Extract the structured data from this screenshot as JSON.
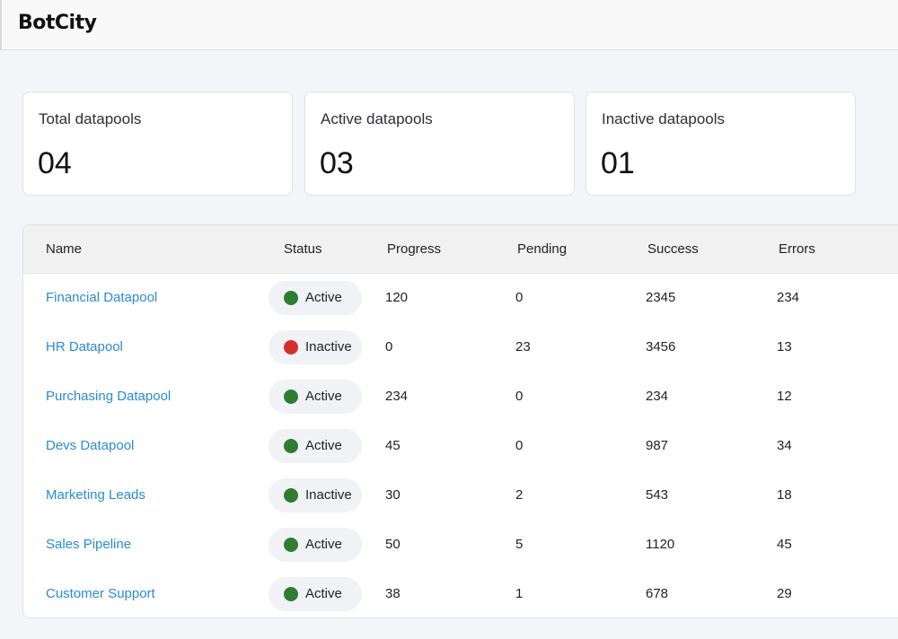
{
  "app": {
    "logo": "BotCity"
  },
  "summary": [
    {
      "label": "Total datapools",
      "value": "04"
    },
    {
      "label": "Active datapools",
      "value": "03"
    },
    {
      "label": "Inactive datapools",
      "value": "01"
    }
  ],
  "table": {
    "headers": [
      "Name",
      "Status",
      "Progress",
      "Pending",
      "Success",
      "Errors"
    ],
    "rows": [
      {
        "name": "Financial Datapool",
        "status": "Active",
        "status_color": "#2e7d32",
        "progress": "120",
        "pending": "0",
        "success": "2345",
        "errors": "234"
      },
      {
        "name": "HR Datapool",
        "status": "Inactive",
        "status_color": "#d32f2f",
        "progress": "0",
        "pending": "23",
        "success": "3456",
        "errors": "13"
      },
      {
        "name": "Purchasing Datapool",
        "status": "Active",
        "status_color": "#2e7d32",
        "progress": "234",
        "pending": "0",
        "success": "234",
        "errors": "12"
      },
      {
        "name": "Devs Datapool",
        "status": "Active",
        "status_color": "#2e7d32",
        "progress": "45",
        "pending": "0",
        "success": "987",
        "errors": "34"
      },
      {
        "name": "Marketing Leads",
        "status": "Inactive",
        "status_color": "#2e7d32",
        "progress": "30",
        "pending": "2",
        "success": "543",
        "errors": "18"
      },
      {
        "name": "Sales Pipeline",
        "status": "Active",
        "status_color": "#2e7d32",
        "progress": "50",
        "pending": "5",
        "success": "1120",
        "errors": "45"
      },
      {
        "name": "Customer Support",
        "status": "Active",
        "status_color": "#2e7d32",
        "progress": "38",
        "pending": "1",
        "success": "678",
        "errors": "29"
      }
    ]
  },
  "colors": {
    "link": "#2a8bd4",
    "active": "#2e7d32",
    "inactive": "#d32f2f"
  }
}
